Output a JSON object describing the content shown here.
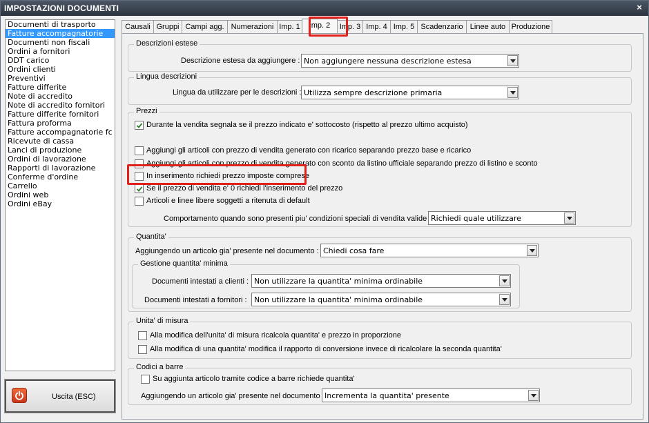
{
  "window": {
    "title": "IMPOSTAZIONI DOCUMENTI",
    "close_glyph": "×"
  },
  "nav": {
    "items": [
      "Documenti di trasporto",
      "Fatture accompagnatorie",
      "Documenti non fiscali",
      "Ordini a fornitori",
      "DDT carico",
      "Ordini clienti",
      "Preventivi",
      "Fatture differite",
      "Note di accredito",
      "Note di accredito fornitori",
      "Fatture differite fornitori",
      "Fattura proforma",
      "Fatture accompagnatorie fc",
      "Ricevute di cassa",
      "Lanci di produzione",
      "Ordini di lavorazione",
      "Rapporti di lavorazione",
      "Conferme d'ordine",
      "Carrello",
      "Ordini web",
      "Ordini eBay"
    ],
    "selected_index": 1
  },
  "exit_button": {
    "label": "Uscita (ESC)",
    "icon": "power-icon"
  },
  "tabs": [
    {
      "label": "Causali"
    },
    {
      "label": "Gruppi"
    },
    {
      "label": "Campi agg."
    },
    {
      "label": "Numerazioni"
    },
    {
      "label": "Imp. 1"
    },
    {
      "label": "Imp. 2"
    },
    {
      "label": "Imp. 3"
    },
    {
      "label": "Imp. 4"
    },
    {
      "label": "Imp. 5"
    },
    {
      "label": "Scadenzario"
    },
    {
      "label": "Linee auto"
    },
    {
      "label": "Produzione"
    }
  ],
  "active_tab": "Imp. 2",
  "highlight_color": "#e0201b",
  "descrizioni": {
    "title": "Descrizioni estese",
    "label": "Descrizione estesa da aggiungere :",
    "value": "Non aggiungere nessuna descrizione estesa"
  },
  "lingua": {
    "title": "Lingua descrizioni",
    "label": "Lingua da utilizzare per le descrizioni :",
    "value": "Utilizza sempre descrizione primaria"
  },
  "prezzi": {
    "title": "Prezzi",
    "checks": [
      {
        "label": "Durante la vendita segnala se il prezzo indicato e' sottocosto (rispetto al prezzo ultimo acquisto)",
        "checked": true
      },
      {
        "label": "Aggiungi gli articoli con prezzo di vendita generato con ricarico separando prezzo base e ricarico",
        "checked": false
      },
      {
        "label": "Aggiungi gli articoli con prezzo di vendita generato con sconto da listino ufficiale separando prezzo di listino e sconto",
        "checked": false
      },
      {
        "label": "In inserimento richiedi prezzo imposte comprese",
        "checked": false
      },
      {
        "label": "Se il prezzo di vendita e' 0 richiedi l'inserimento del prezzo",
        "checked": true
      },
      {
        "label": "Articoli e linee libere soggetti a ritenuta di default",
        "checked": false
      }
    ],
    "condizioni_label": "Comportamento quando sono presenti piu' condizioni speciali di vendita valide :",
    "condizioni_value": "Richiedi quale utilizzare"
  },
  "quantita": {
    "title": "Quantita'",
    "label": "Aggiungendo un articolo gia' presente nel documento :",
    "value": "Chiedi cosa fare",
    "minima": {
      "title": "Gestione quantita' minima",
      "clienti_label": "Documenti intestati a clienti :",
      "clienti_value": "Non utilizzare la quantita' minima ordinabile",
      "fornitori_label": "Documenti intestati a fornitori :",
      "fornitori_value": "Non utilizzare la quantita' minima ordinabile"
    }
  },
  "unita": {
    "title": "Unita' di misura",
    "checks": [
      {
        "label": "Alla modifica dell'unita' di misura ricalcola quantita' e prezzo in proporzione",
        "checked": false
      },
      {
        "label": "Alla modifica di una quantita' modifica il rapporto di conversione invece di ricalcolare la seconda quantita'",
        "checked": false
      }
    ]
  },
  "barre": {
    "title": "Codici a barre",
    "check": {
      "label": "Su aggiunta articolo tramite codice a barre richiede quantita'",
      "checked": false
    },
    "label": "Aggiungendo un articolo gia' presente nel documento :",
    "value": "Incrementa la quantita' presente"
  }
}
